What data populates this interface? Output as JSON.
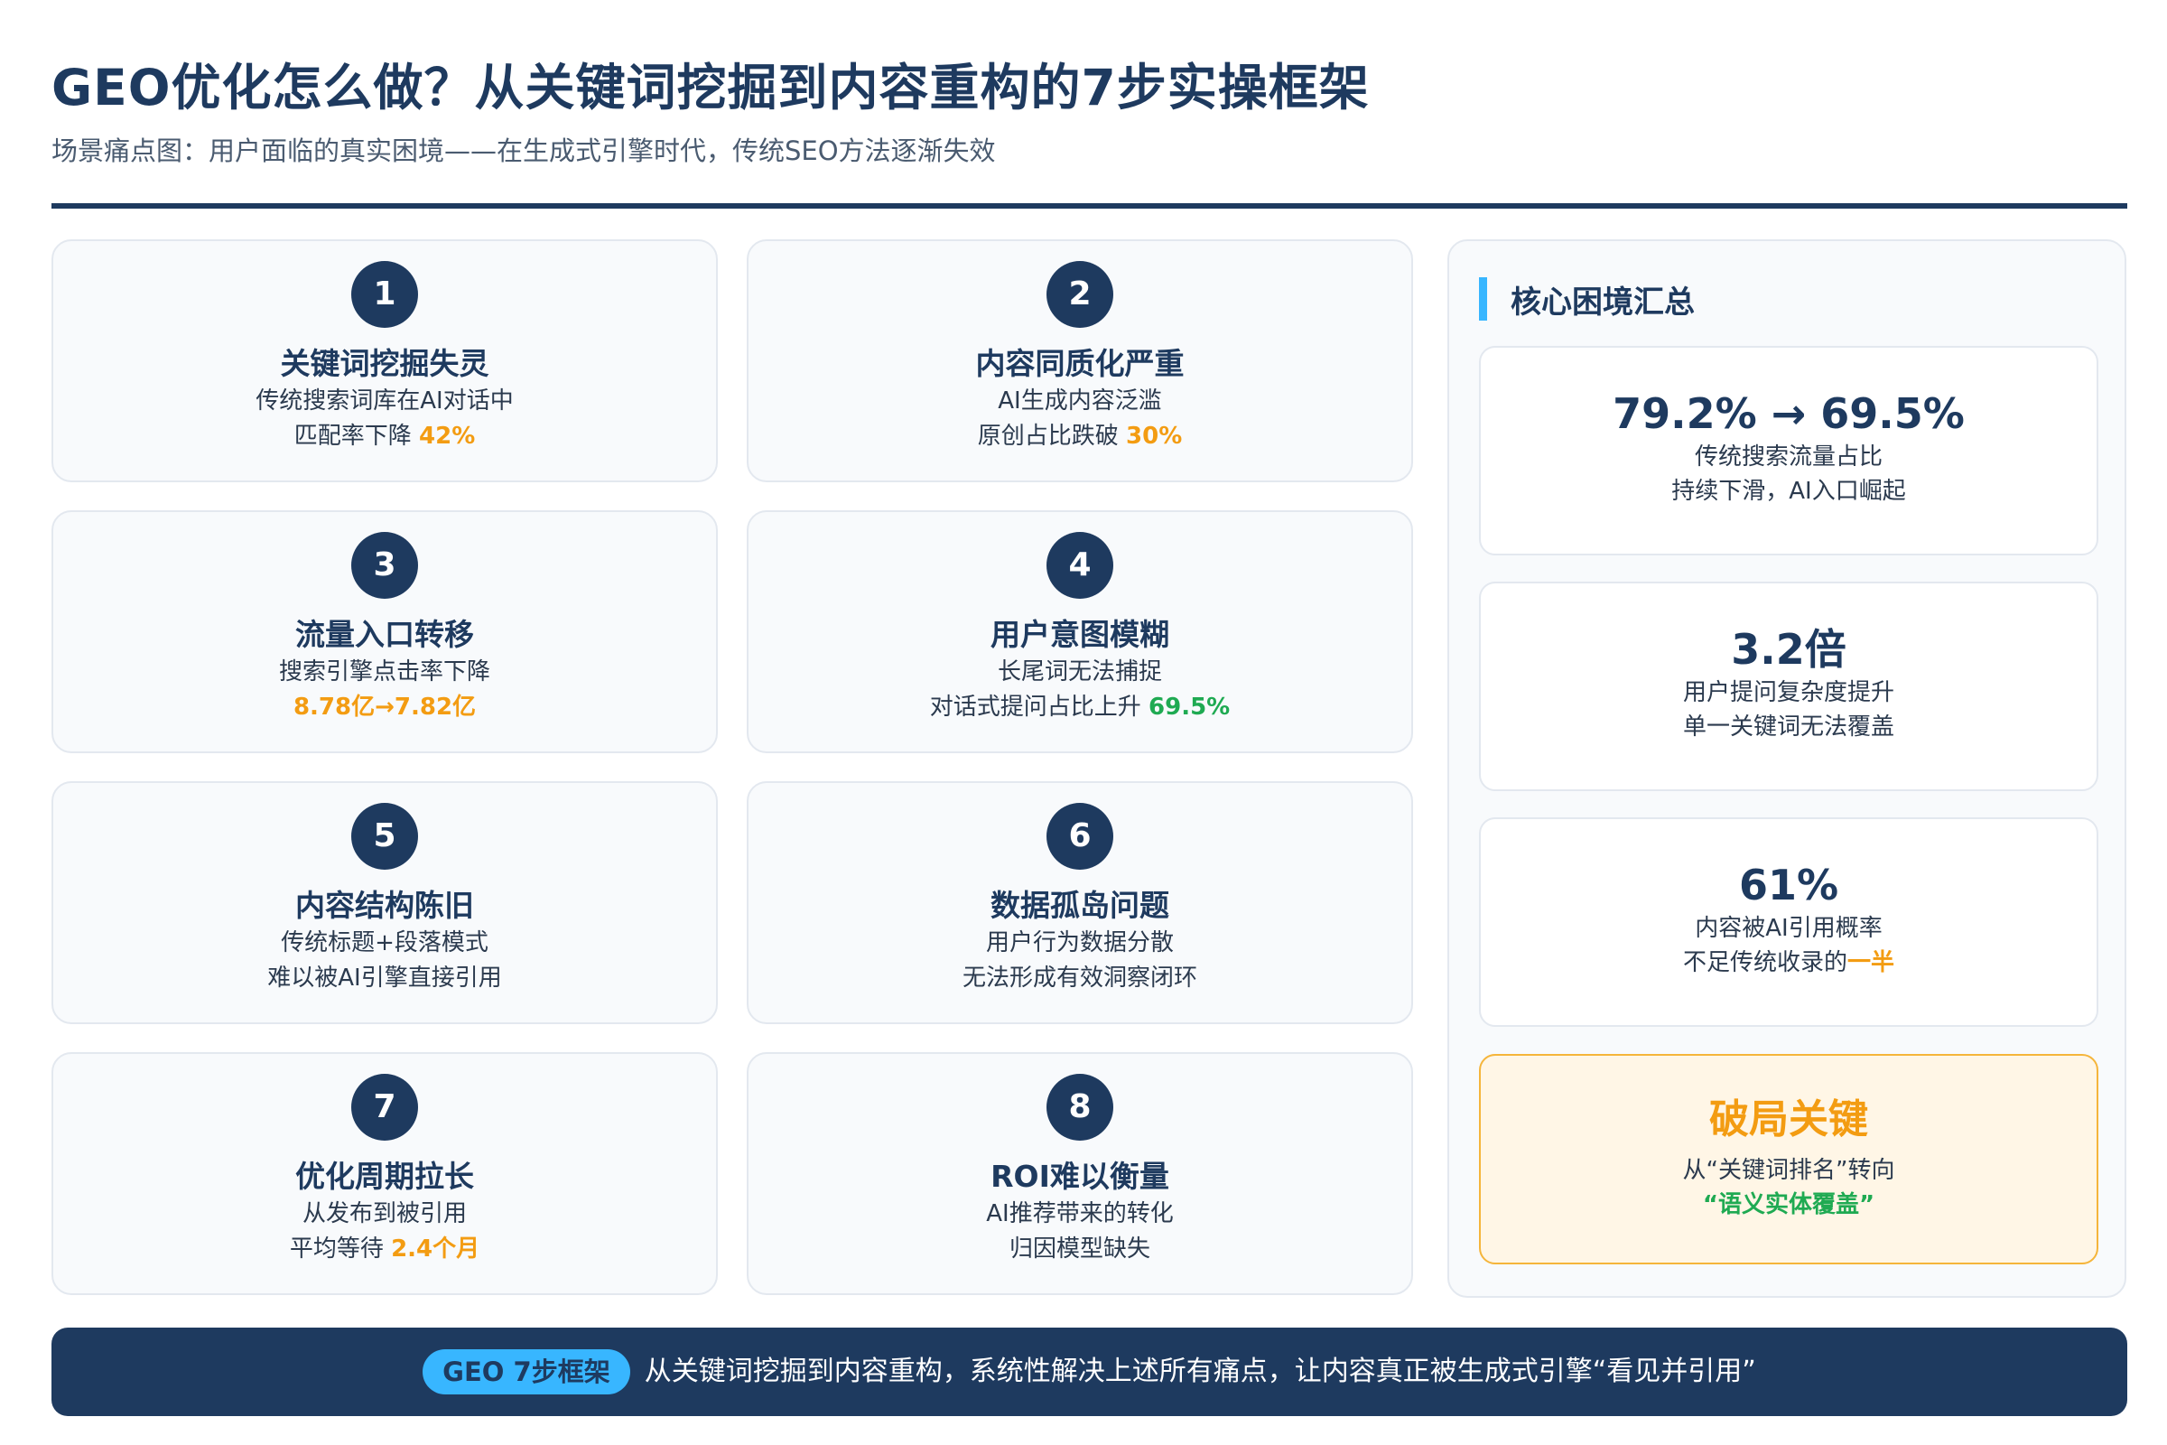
{
  "header": {
    "title": "GEO优化怎么做？从关键词挖掘到内容重构的7步实操框架",
    "subtitle": "场景痛点图：用户面临的真实困境——在生成式引擎时代，传统SEO方法逐渐失效"
  },
  "cards": [
    {
      "num": "1",
      "title": "关键词挖掘失灵",
      "line1": "传统搜索词库在AI对话中",
      "line2_pre": "匹配率下降 ",
      "line2_hl": "42%"
    },
    {
      "num": "2",
      "title": "内容同质化严重",
      "line1": "AI生成内容泛滥",
      "line2_pre": "原创占比跌破 ",
      "line2_hl": "30%"
    },
    {
      "num": "3",
      "title": "流量入口转移",
      "line1": "搜索引擎点击率下降",
      "line2_pre": "",
      "line2_hl": "8.78亿→7.82亿"
    },
    {
      "num": "4",
      "title": "用户意图模糊",
      "line1": "长尾词无法捕捉",
      "line2_pre": "对话式提问占比上升 ",
      "line2_hl": "69.5%"
    },
    {
      "num": "5",
      "title": "内容结构陈旧",
      "line1": "传统标题+段落模式",
      "line2_pre": "难以被AI引擎直接引用",
      "line2_hl": ""
    },
    {
      "num": "6",
      "title": "数据孤岛问题",
      "line1": "用户行为数据分散",
      "line2_pre": "无法形成有效洞察闭环",
      "line2_hl": ""
    },
    {
      "num": "7",
      "title": "优化周期拉长",
      "line1": "从发布到被引用",
      "line2_pre": "平均等待 ",
      "line2_hl": "2.4个月"
    },
    {
      "num": "8",
      "title": "ROI难以衡量",
      "line1": "AI推荐带来的转化",
      "line2_pre": "归因模型缺失",
      "line2_hl": ""
    }
  ],
  "summary": {
    "title": "核心困境汇总",
    "stats": [
      {
        "big": "79.2% → 69.5%",
        "line1": "传统搜索流量占比",
        "line2_pre": "持续下滑，AI入口崛起",
        "line2_hl": ""
      },
      {
        "big": "3.2倍",
        "line1": "用户提问复杂度提升",
        "line2_pre": "单一关键词无法覆盖",
        "line2_hl": ""
      },
      {
        "big": "61%",
        "line1": "内容被AI引用概率",
        "line2_pre": "不足传统收录的",
        "line2_hl": "一半"
      }
    ],
    "key": {
      "title": "破局关键",
      "line1": "从“关键词排名”转向",
      "line2": "“语义实体覆盖”"
    }
  },
  "footer": {
    "pill": "GEO 7步框架",
    "text": "从关键词挖掘到内容重构，系统性解决上述所有痛点，让内容真正被生成式引擎“看见并引用”"
  },
  "colors": {
    "navy": "#1e3a5f",
    "orange": "#f39c12",
    "green": "#1faa52",
    "accent_blue": "#38b6ff"
  }
}
